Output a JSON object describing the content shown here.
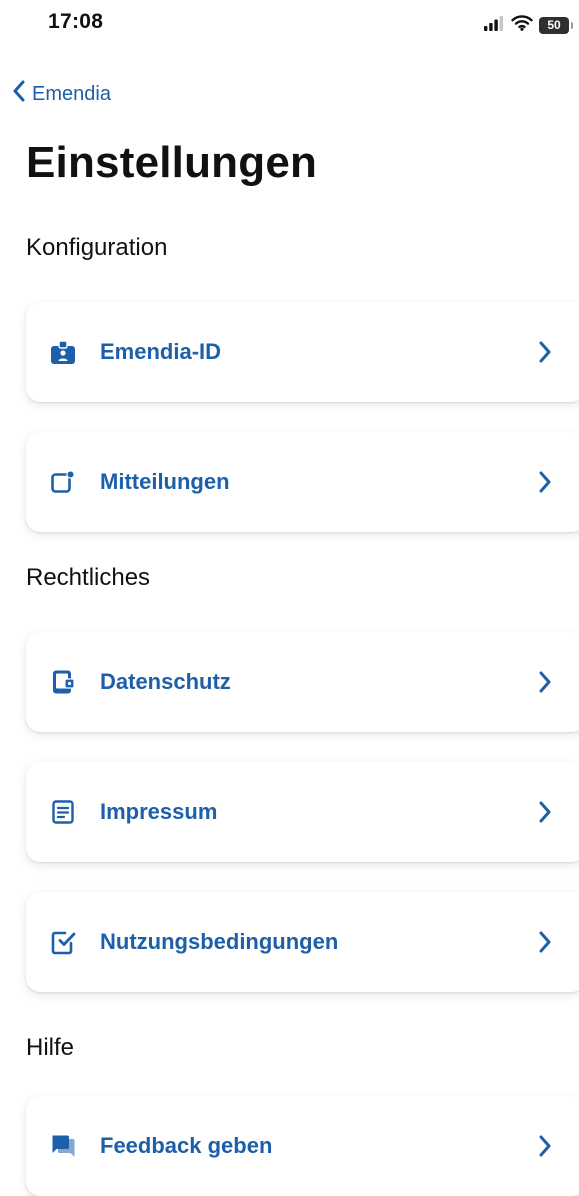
{
  "status_bar": {
    "time": "17:08",
    "battery_level": "50",
    "signal_icon": "cellular-signal-icon",
    "wifi_icon": "wifi-icon"
  },
  "nav": {
    "back_label": "Emendia",
    "back_icon": "chevron-left-icon"
  },
  "page": {
    "title": "Einstellungen"
  },
  "colors": {
    "accent": "#1d5fa8",
    "text": "#111111",
    "background": "#ffffff"
  },
  "sections": [
    {
      "header": "Konfiguration",
      "items": [
        {
          "label": "Emendia-ID",
          "icon": "id-badge-icon"
        },
        {
          "label": "Mitteilungen",
          "icon": "notification-icon"
        }
      ]
    },
    {
      "header": "Rechtliches",
      "items": [
        {
          "label": "Datenschutz",
          "icon": "privacy-device-icon"
        },
        {
          "label": "Impressum",
          "icon": "document-icon"
        },
        {
          "label": "Nutzungsbedingungen",
          "icon": "terms-checkbox-icon"
        }
      ]
    },
    {
      "header": "Hilfe",
      "items": [
        {
          "label": "Feedback geben",
          "icon": "feedback-chat-icon"
        }
      ]
    }
  ]
}
